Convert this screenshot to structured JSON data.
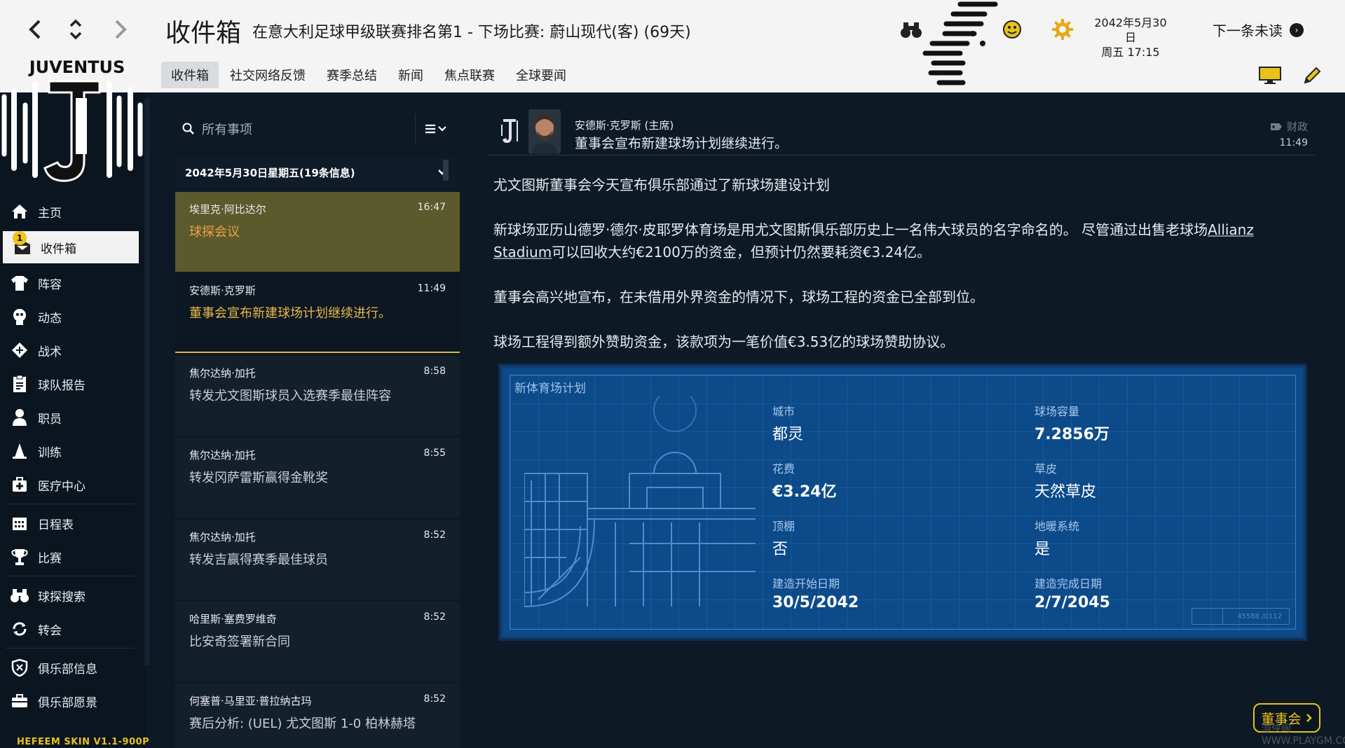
{
  "header": {
    "title": "收件箱",
    "subtitle": "在意大利足球甲级联赛排名第1 - 下场比赛: 蔚山现代(客) (69天)",
    "back_icon": "chevron-left-icon",
    "forward_icon": "chevron-right-icon",
    "date_line1": "2042年5月30日",
    "date_line2": "周五 17:15",
    "next_unread": "下一条未读"
  },
  "tabs": [
    "收件箱",
    "社交网络反馈",
    "赛季总结",
    "新闻",
    "焦点联赛",
    "全球要闻"
  ],
  "club": {
    "name": "JUVENTUS"
  },
  "sidebar": {
    "items": [
      {
        "label": "主页",
        "icon": "home-icon"
      },
      {
        "label": "收件箱",
        "icon": "inbox-icon",
        "badge": "1"
      },
      {
        "label": "阵容",
        "icon": "shirt-icon"
      },
      {
        "label": "动态",
        "icon": "dynamics-icon"
      },
      {
        "label": "战术",
        "icon": "tactics-icon"
      },
      {
        "label": "球队报告",
        "icon": "report-icon"
      },
      {
        "label": "职员",
        "icon": "staff-icon"
      },
      {
        "label": "训练",
        "icon": "cone-icon"
      },
      {
        "label": "医疗中心",
        "icon": "medical-icon"
      },
      {
        "label": "日程表",
        "icon": "calendar-icon"
      },
      {
        "label": "比赛",
        "icon": "trophy-icon"
      },
      {
        "label": "球探搜索",
        "icon": "binoculars-icon"
      },
      {
        "label": "转会",
        "icon": "transfer-icon"
      },
      {
        "label": "俱乐部信息",
        "icon": "shield-icon"
      },
      {
        "label": "俱乐部愿景",
        "icon": "briefcase-icon"
      }
    ],
    "skin": "HEFEEM SKIN V1.1-900P"
  },
  "list": {
    "search_placeholder": "所有事项",
    "date_header": "2042年5月30日星期五(19条信息)",
    "messages": [
      {
        "sender": "埃里克·阿比达尔",
        "time": "16:47",
        "subject": "球探会议"
      },
      {
        "sender": "安德斯·克罗斯",
        "time": "11:49",
        "subject": "董事会宣布新建球场计划继续进行。"
      },
      {
        "sender": "焦尔达纳·加托",
        "time": "8:58",
        "subject": "转发尤文图斯球员入选赛季最佳阵容"
      },
      {
        "sender": "焦尔达纳·加托",
        "time": "8:55",
        "subject": "转发冈萨雷斯赢得金靴奖"
      },
      {
        "sender": "焦尔达纳·加托",
        "time": "8:52",
        "subject": "转发吉赢得赛季最佳球员"
      },
      {
        "sender": "哈里斯·塞费罗维奇",
        "time": "8:52",
        "subject": "比安奇签署新合同"
      },
      {
        "sender": "何塞普·马里亚·普拉纳古玛",
        "time": "8:52",
        "subject": "赛后分析: (UEL) 尤文图斯 1-0 柏林赫塔"
      }
    ]
  },
  "detail": {
    "from": "安德斯·克罗斯 (主席)",
    "subject": "董事会宣布新建球场计划继续进行。",
    "tag": "财政",
    "time": "11:49",
    "p1": "尤文图斯董事会今天宣布俱乐部通过了新球场建设计划",
    "p2a": "新球场亚历山德罗·德尔·皮耶罗体育场是用尤文图斯俱乐部历史上一名伟大球员的名字命名的。 尽管通过出售老球场",
    "p2b": "Allianz Stadium",
    "p2c": "可以回收大约€2100万的资金，但预计仍然要耗资€3.24亿。",
    "p3": "董事会高兴地宣布，在未借用外界资金的情况下，球场工程的资金已全部到位。",
    "p4": "球场工程得到额外赞助资金，该款项为一笔价值€3.53亿的球场赞助协议。"
  },
  "blueprint": {
    "title": "新体育场计划",
    "fields": [
      {
        "label": "城市",
        "value": "都灵"
      },
      {
        "label": "球场容量",
        "value": "7.2856万"
      },
      {
        "label": "花费",
        "value": "€3.24亿"
      },
      {
        "label": "草皮",
        "value": "天然草皮"
      },
      {
        "label": "顶棚",
        "value": "否"
      },
      {
        "label": "地暖系统",
        "value": "是"
      },
      {
        "label": "建造开始日期",
        "value": "30/5/2042"
      },
      {
        "label": "建造完成日期",
        "value": "2/7/2045"
      }
    ],
    "code": "45588 /0112"
  },
  "board_button": "董事会",
  "watermark": "游侠网 WWW.PLAYGM.CC",
  "colors": {
    "accent": "#e8c21a",
    "selected_msg": "#5b5a2c",
    "blueprint": "#0c4a8a"
  }
}
